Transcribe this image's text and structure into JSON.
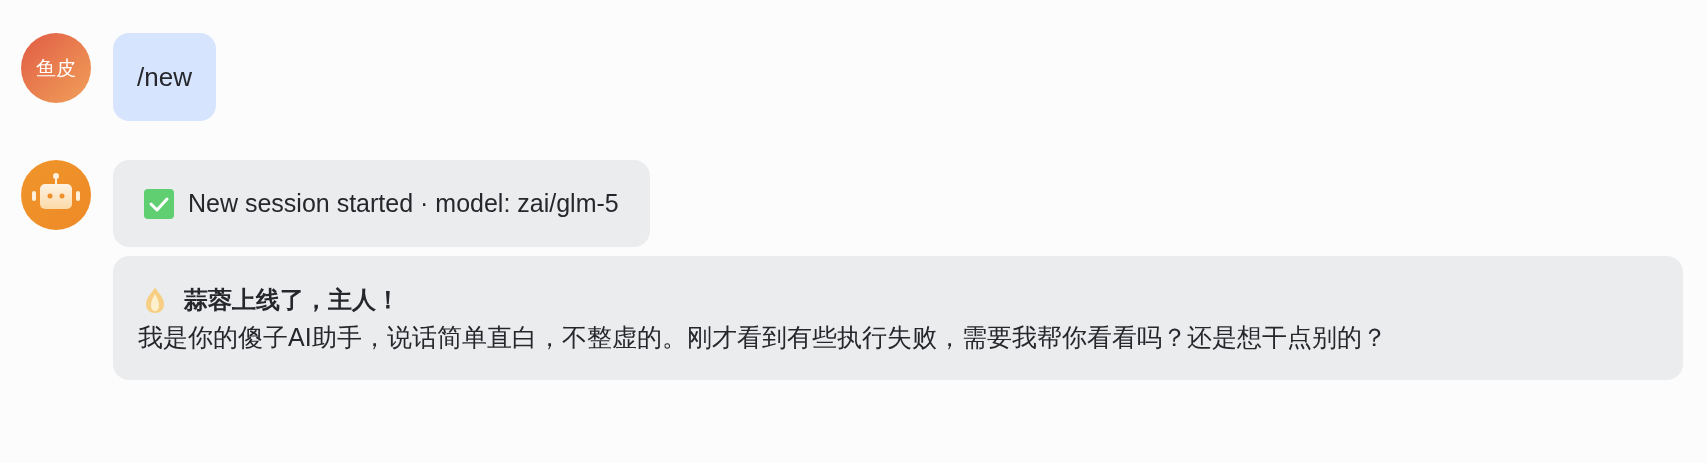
{
  "messages": [
    {
      "kind": "user",
      "avatar": "鱼皮",
      "bubbles": [
        {
          "kind": "text",
          "text": "/new"
        }
      ]
    },
    {
      "kind": "bot",
      "bubbles": [
        {
          "kind": "status",
          "text": "New session started · model: zai/glm-5"
        },
        {
          "kind": "card",
          "title": "蒜蓉上线了，主人！",
          "body": "我是你的傻子AI助手，说话简单直白，不整虚的。刚才看到有些执行失败，需要我帮你看看吗？还是想干点别的？"
        }
      ]
    }
  ]
}
